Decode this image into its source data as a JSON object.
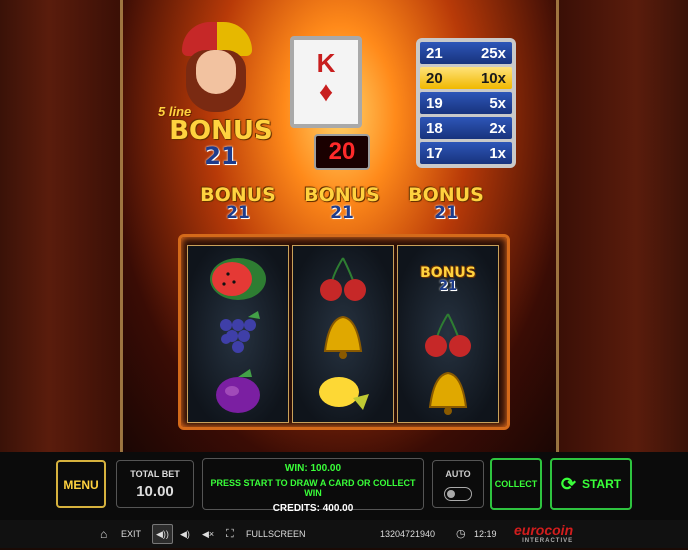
{
  "header": {
    "logo_prefix": "5 line",
    "logo_word": "BONUS",
    "logo_number": "21"
  },
  "card": {
    "rank": "K",
    "suit": "♦",
    "suit_color": "#c81e1e"
  },
  "count": "20",
  "paytable": [
    {
      "total": "21",
      "mult": "25x",
      "active": false
    },
    {
      "total": "20",
      "mult": "10x",
      "active": true
    },
    {
      "total": "19",
      "mult": "5x",
      "active": false
    },
    {
      "total": "18",
      "mult": "2x",
      "active": false
    },
    {
      "total": "17",
      "mult": "1x",
      "active": false
    }
  ],
  "reel_headers": [
    {
      "word": "BONUS",
      "number": "21"
    },
    {
      "word": "BONUS",
      "number": "21"
    },
    {
      "word": "BONUS",
      "number": "21"
    }
  ],
  "reels": [
    [
      "watermelon",
      "grapes",
      "plum"
    ],
    [
      "cherries",
      "bell",
      "lemon"
    ],
    [
      "bonus-21",
      "cherries",
      "bell"
    ]
  ],
  "reel_bonus_symbol": {
    "word": "BONUS",
    "number": "21"
  },
  "controls": {
    "menu": "MENU",
    "total_bet_label": "TOTAL BET",
    "total_bet_value": "10.00",
    "win": "WIN: 100.00",
    "prompt": "PRESS START TO DRAW A CARD OR COLLECT WIN",
    "credits": "CREDITS: 400.00",
    "auto": "AUTO",
    "collect": "COLLECT",
    "start": "START"
  },
  "bottom_bar": {
    "exit": "EXIT",
    "fullscreen": "FULLSCREEN",
    "session_id": "13204721940",
    "time": "12:19",
    "brand": "eurocoin",
    "brand_sub": "INTERACTIVE"
  },
  "colors": {
    "accent_gold": "#ffd23f",
    "win_green": "#39ff39",
    "count_red": "#ff2a2a"
  }
}
